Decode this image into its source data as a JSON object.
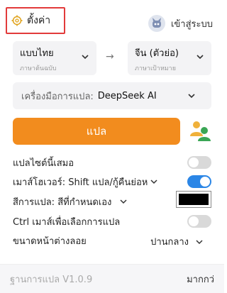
{
  "header": {
    "settings_label": "ตั้งค่า",
    "login_label": "เข้าสู่ระบบ"
  },
  "languages": {
    "source": {
      "name": "แบบไทย",
      "caption": "ภาษาต้นฉบับ"
    },
    "target": {
      "name": "จีน (ตัวย่อ)",
      "caption": "ภาษาเป้าหมาย"
    }
  },
  "tool": {
    "label": "เครื่องมือการแปล:",
    "value": "DeepSeek AI"
  },
  "translate_button": "แปล",
  "options": {
    "always_translate": {
      "label": "แปลไซต์นี้เสมอ",
      "enabled": false
    },
    "hover": {
      "label": "เมาส์โฮเวอร์: Shift แปล/กู้คืนย่อห",
      "enabled": true
    },
    "color": {
      "label": "สีการแปล: สีที่กำหนดเอง",
      "value": "#000000"
    },
    "ctrl_select": {
      "label": "Ctrl เมาส์เพื่อเลือกการแปล",
      "enabled": false
    },
    "float_size": {
      "label": "ขนาดหน้าต่างลอย",
      "value": "ปานกลาง"
    }
  },
  "footer": {
    "version": "ฐานการแปล V1.0.9",
    "more_label": "มากกว่"
  },
  "colors": {
    "accent": "#f28c1e",
    "toggle_on": "#2b86e6",
    "highlight_border": "#e23b3b"
  }
}
